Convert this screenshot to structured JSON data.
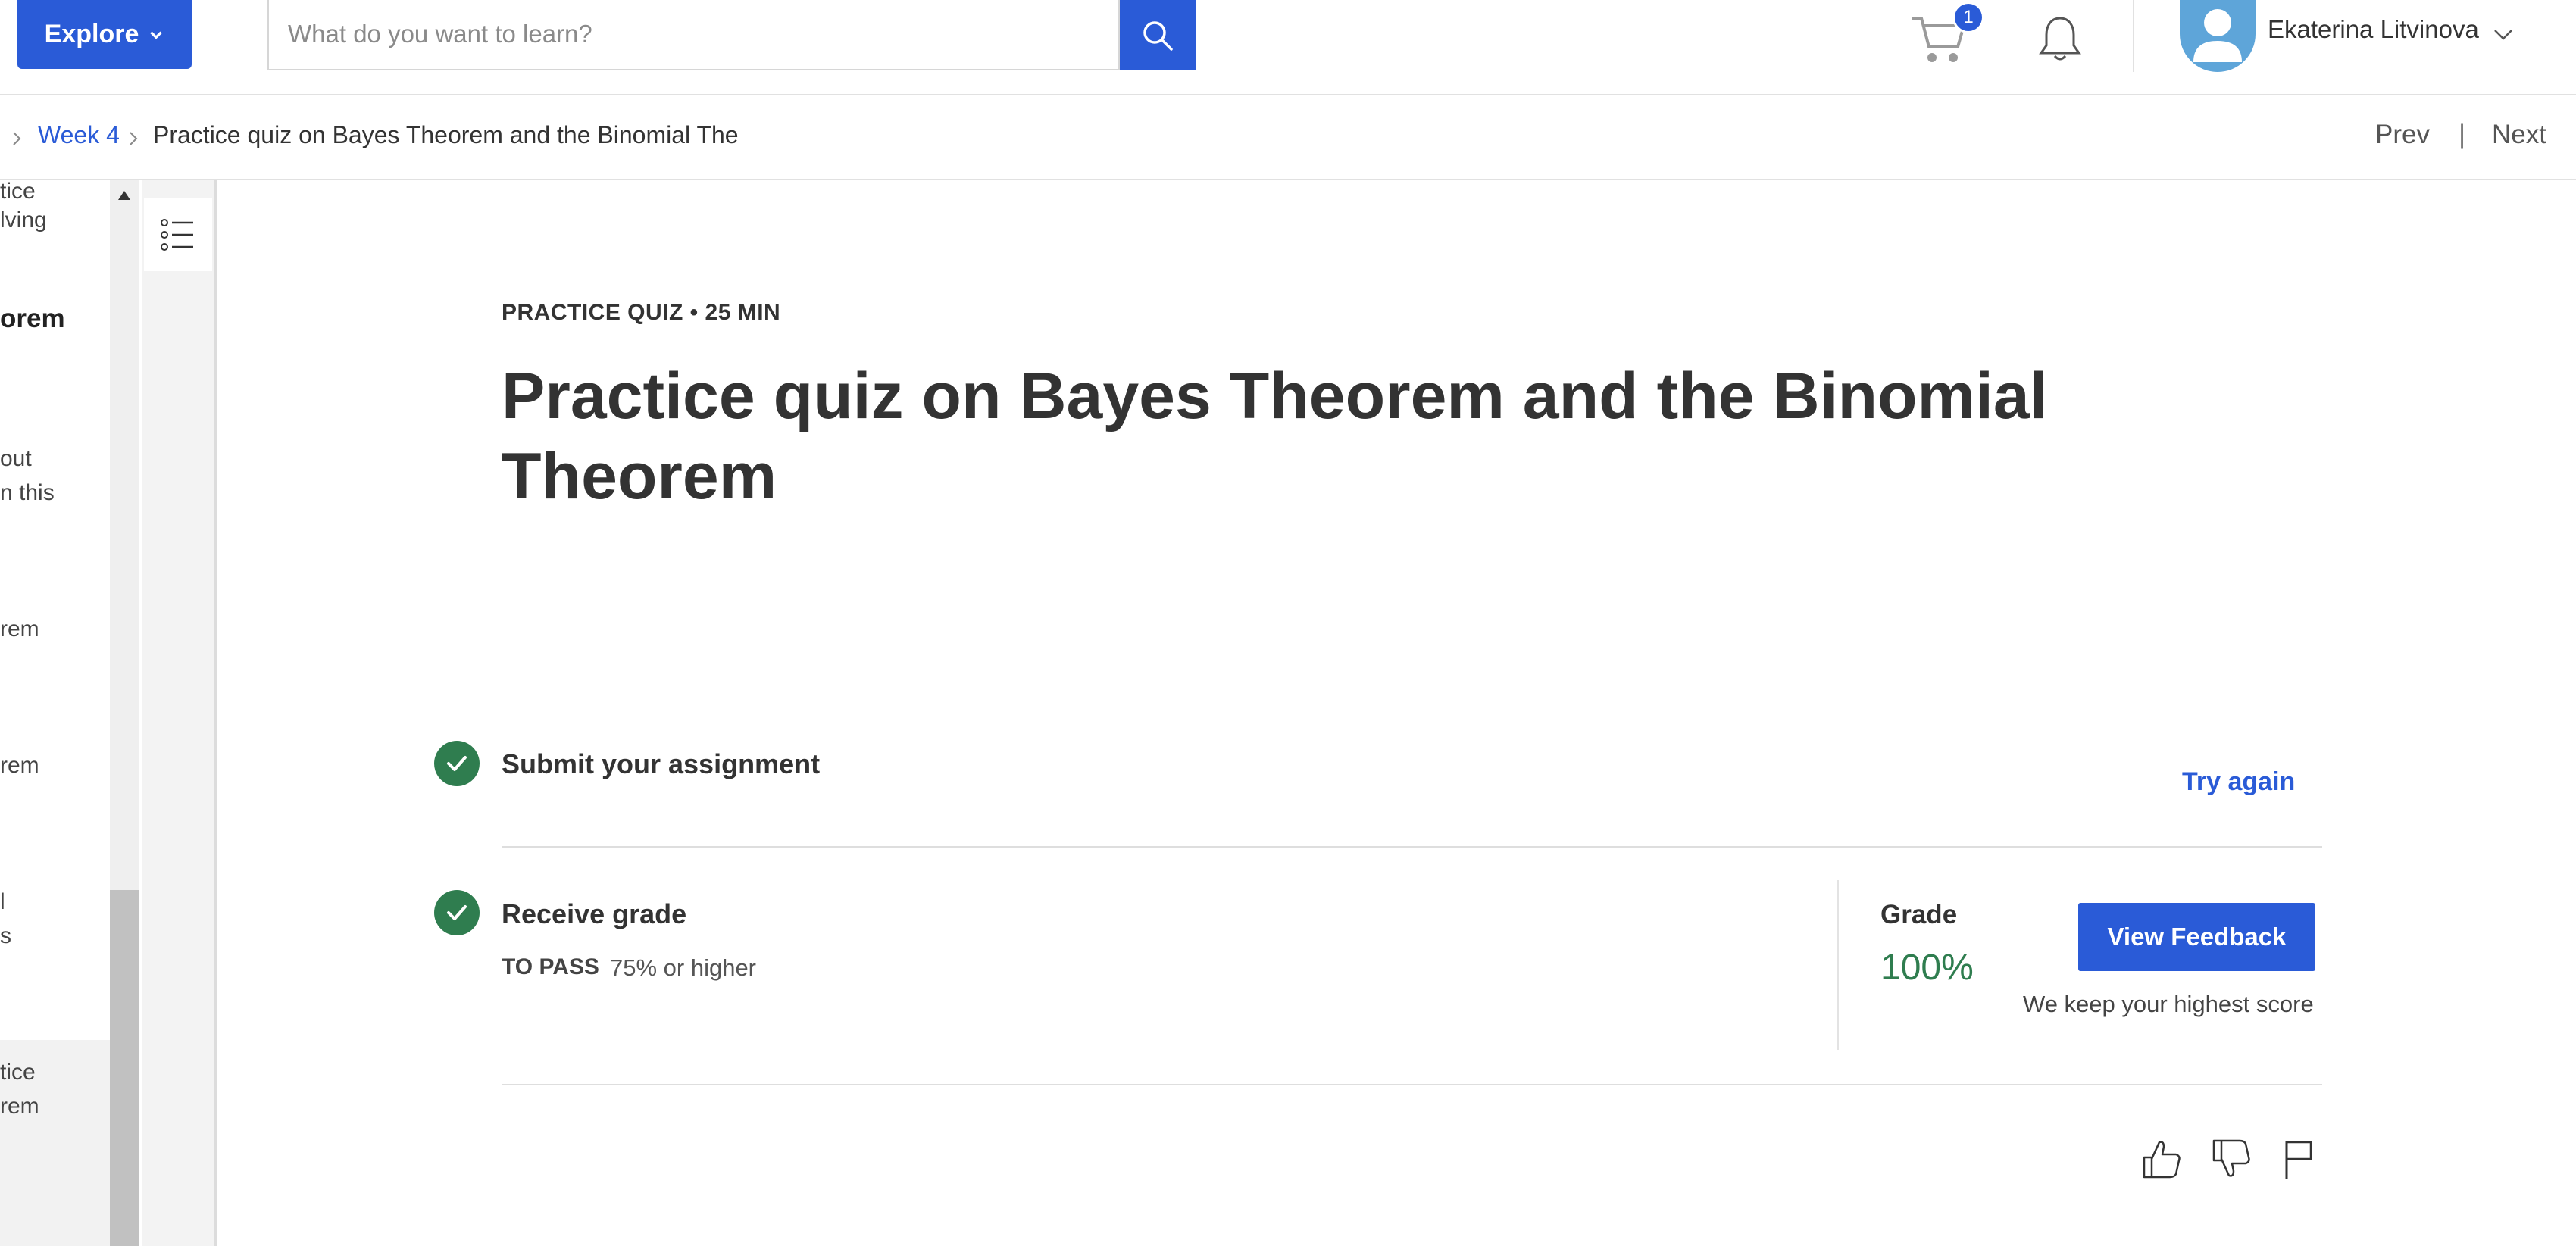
{
  "header": {
    "explore_label": "Explore",
    "search_placeholder": "What do you want to learn?",
    "cart_count": "1",
    "user_name": "Ekaterina Litvinova"
  },
  "breadcrumb": {
    "week": "Week 4",
    "current": "Practice quiz on Bayes Theorem and the Binomial The"
  },
  "nav": {
    "prev": "Prev",
    "divider": "|",
    "next": "Next"
  },
  "sidebar": {
    "items": [
      "tice",
      "lving",
      "orem",
      "out",
      "n this",
      "rem",
      "rem",
      "l",
      "s",
      "tice",
      "rem"
    ]
  },
  "quiz": {
    "eyebrow": "PRACTICE QUIZ • 25 MIN",
    "title": "Practice quiz on Bayes Theorem and the Binomial Theorem",
    "submit_title": "Submit your assignment",
    "try_again": "Try again",
    "receive_title": "Receive grade",
    "to_pass_label": "TO PASS",
    "to_pass_value": "75% or higher",
    "grade_label": "Grade",
    "grade_value": "100%",
    "view_feedback": "View Feedback",
    "highest_note": "We keep your highest score"
  },
  "colors": {
    "primary": "#2a5bd7",
    "success": "#2f7d4f"
  },
  "icons": [
    "search-icon",
    "cart-icon",
    "bell-icon",
    "chevron-down-icon",
    "list-icon",
    "thumbs-up-icon",
    "thumbs-down-icon",
    "flag-icon"
  ]
}
